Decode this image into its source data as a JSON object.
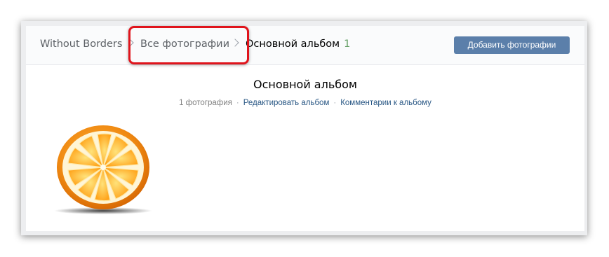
{
  "breadcrumbs": {
    "group": "Without Borders",
    "all_photos": "Все фотографии",
    "current": "Основной альбом",
    "current_count": "1"
  },
  "header": {
    "add_button_label": "Добавить фотографии"
  },
  "album": {
    "title": "Основной альбом",
    "photo_count": "1 фотография",
    "separator": "·",
    "edit_link": "Редактировать альбом",
    "comments_link": "Комментарии к альбому"
  },
  "photos": [
    {
      "subject": "orange-slice"
    }
  ],
  "colors": {
    "button": "#5b7faa",
    "link": "#2a5885",
    "highlight": "#e0141c",
    "count": "#66a066"
  }
}
